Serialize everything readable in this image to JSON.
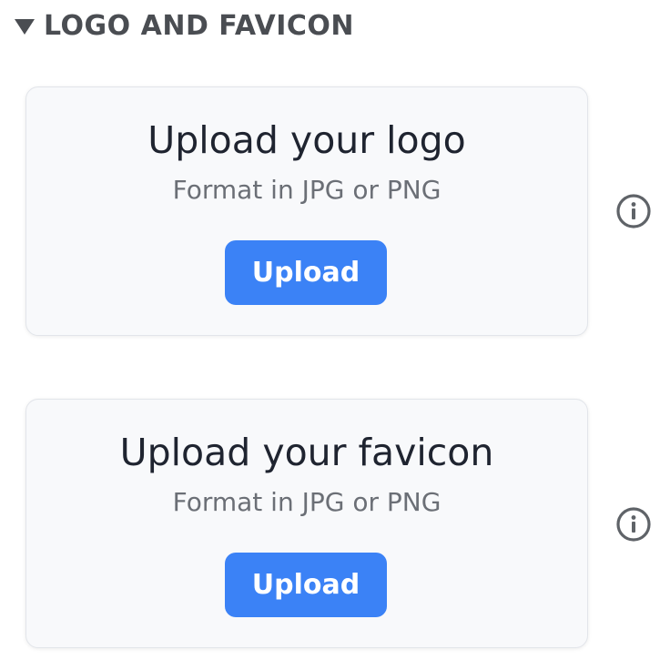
{
  "section": {
    "title": "LOGO AND FAVICON",
    "toggle_icon": "caret-down-icon"
  },
  "logo_card": {
    "title": "Upload your logo",
    "subtitle": "Format in JPG or PNG",
    "button_label": "Upload",
    "info_icon": "info-icon"
  },
  "favicon_card": {
    "title": "Upload your favicon",
    "subtitle": "Format in JPG or PNG",
    "button_label": "Upload",
    "info_icon": "info-icon"
  },
  "colors": {
    "accent": "#3b82f6",
    "header_text": "#4a4d52",
    "card_background": "#f8f9fb",
    "title_text": "#1f2430",
    "subtitle_text": "#6b6f76"
  }
}
